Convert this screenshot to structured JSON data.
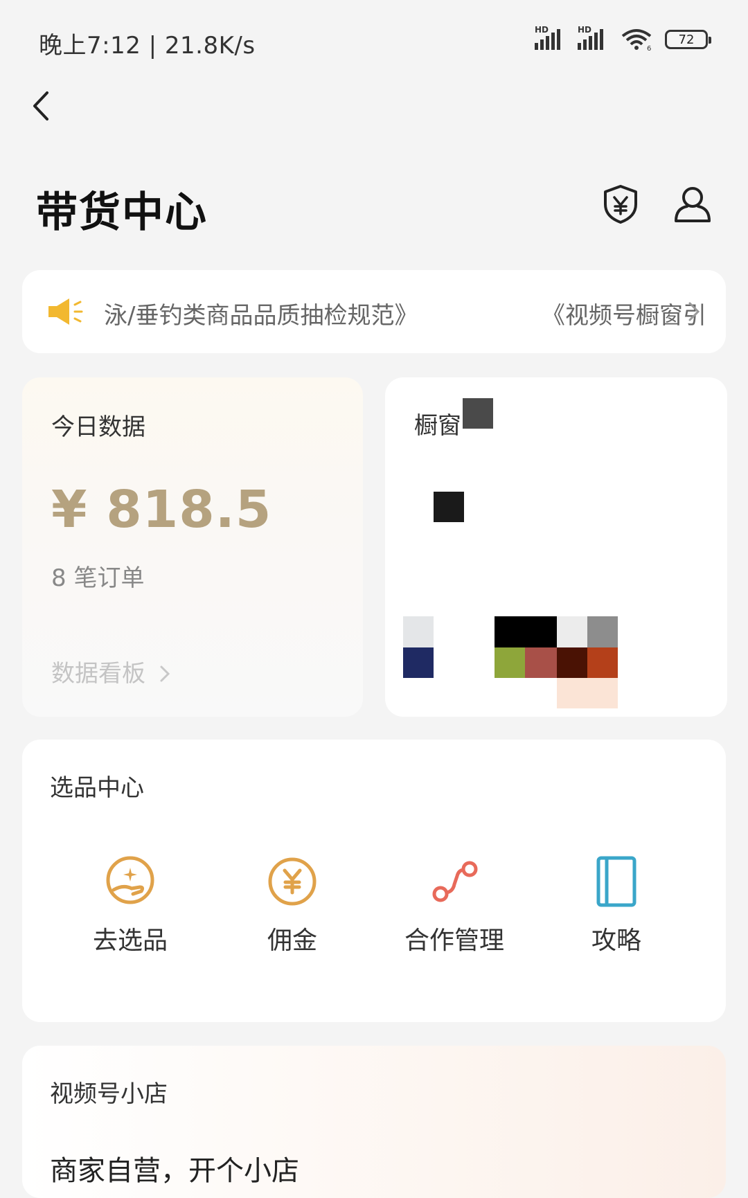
{
  "status_bar": {
    "time": "晚上7:12 | 21.8K/s",
    "battery": "72",
    "hd1": "HD",
    "hd2": "HD",
    "wifi_sub": "6"
  },
  "header": {
    "title": "带货中心"
  },
  "notice": {
    "text": "泳/垂钓类商品品质抽检规范》",
    "text_right": "《视频号橱窗引"
  },
  "today": {
    "label": "今日数据",
    "amount": "¥ 818.5",
    "orders": "8 笔订单",
    "dashboard_link": "数据看板"
  },
  "showcase": {
    "label": "橱窗"
  },
  "selection": {
    "title": "选品中心",
    "tools": [
      {
        "label": "去选品",
        "icon": "pick-product-icon",
        "color": "#e0a24a"
      },
      {
        "label": "佣金",
        "icon": "yuan-coin-icon",
        "color": "#e0a24a"
      },
      {
        "label": "合作管理",
        "icon": "cooperation-nodes-icon",
        "color": "#e86a5a"
      },
      {
        "label": "攻略",
        "icon": "book-icon",
        "color": "#3aa6c9"
      }
    ]
  },
  "shop": {
    "title": "视频号小店",
    "subtitle": "商家自营，开个小店"
  },
  "colors": {
    "accent_gold": "#b5a27f",
    "notice_speaker": "#f2b830",
    "page_bg": "#f4f4f4"
  }
}
